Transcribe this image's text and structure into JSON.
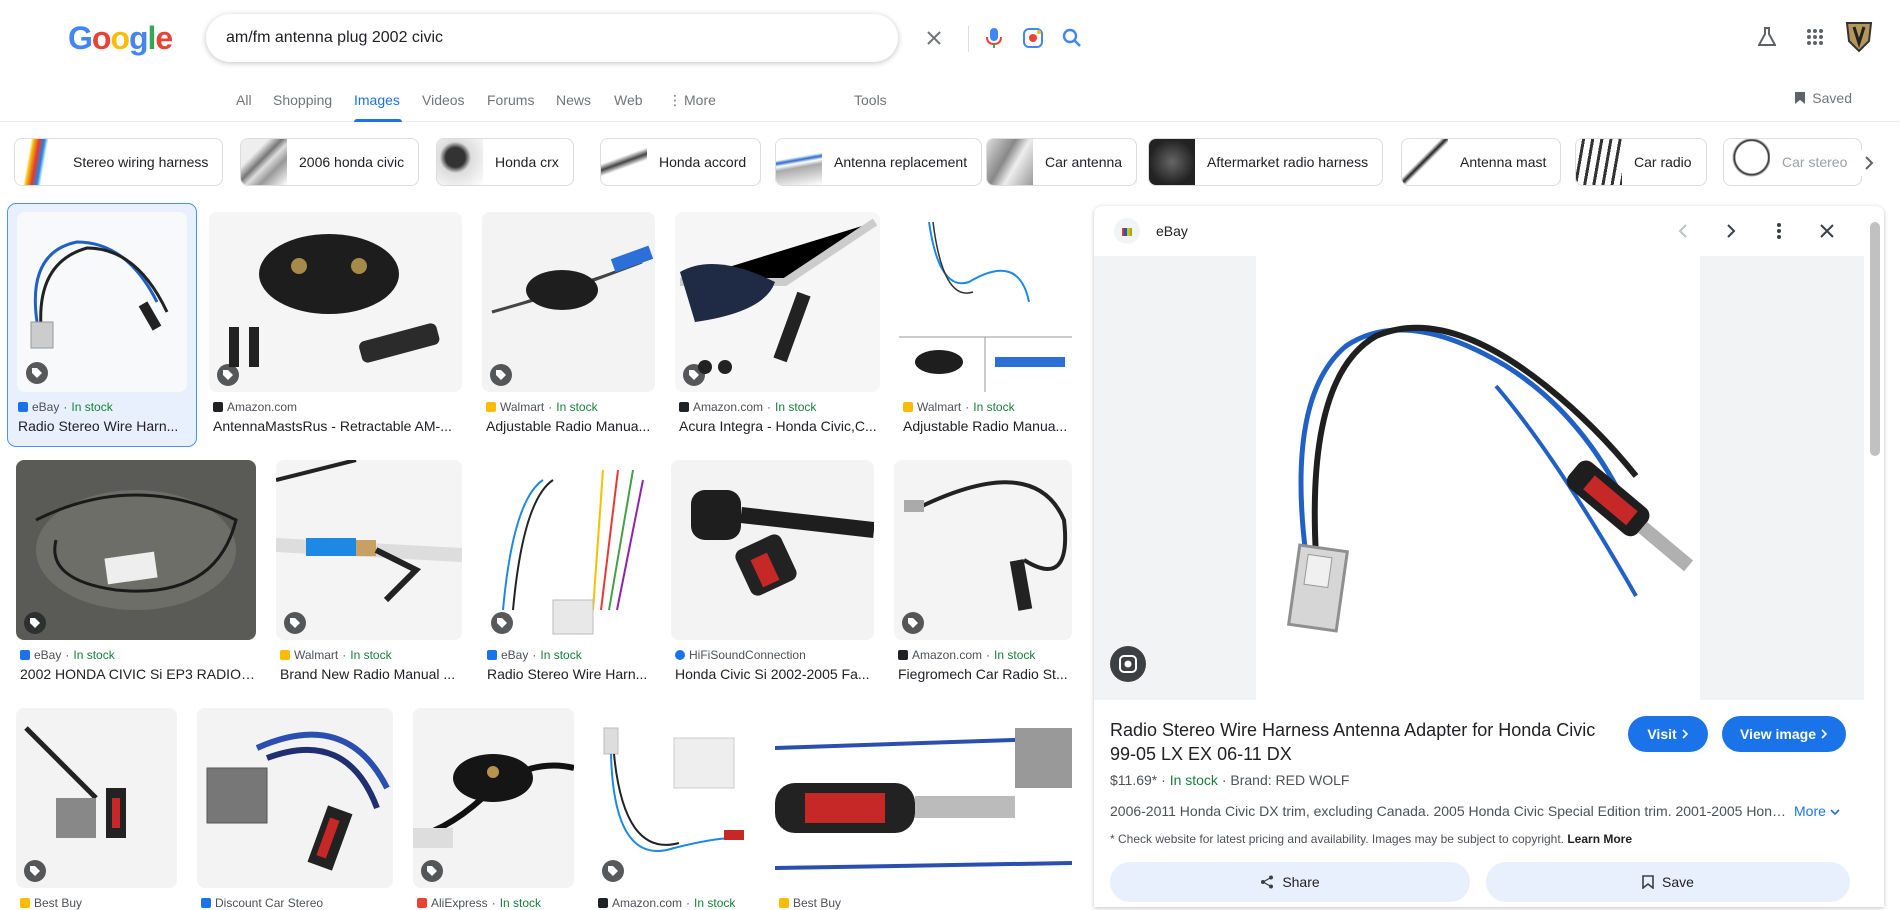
{
  "search": {
    "query": "am/fm antenna plug 2002 civic"
  },
  "logo": {
    "text": "Google"
  },
  "tabs": [
    {
      "label": "All"
    },
    {
      "label": "Shopping"
    },
    {
      "label": "Images"
    },
    {
      "label": "Videos"
    },
    {
      "label": "Forums"
    },
    {
      "label": "News"
    },
    {
      "label": "Web"
    },
    {
      "label": "More"
    },
    {
      "label": "Tools"
    }
  ],
  "saved_label": "Saved",
  "chips": [
    {
      "label": "Stereo wiring harness"
    },
    {
      "label": "2006 honda civic"
    },
    {
      "label": "Honda crx"
    },
    {
      "label": "Honda accord"
    },
    {
      "label": "Antenna replacement"
    },
    {
      "label": "Car antenna"
    },
    {
      "label": "Aftermarket radio harness"
    },
    {
      "label": "Antenna mast"
    },
    {
      "label": "Car radio"
    },
    {
      "label": "Car stereo"
    }
  ],
  "results": [
    {
      "source": "eBay",
      "stock": "In stock",
      "title": "Radio Stereo Wire Harn...",
      "color": "#1a73e8"
    },
    {
      "source": "Amazon.com",
      "stock": "",
      "title": "AntennaMastsRus - Retractable AM-...",
      "color": "#202124"
    },
    {
      "source": "Walmart",
      "stock": "In stock",
      "title": "Adjustable Radio Manua...",
      "color": "#fbbc05"
    },
    {
      "source": "Amazon.com",
      "stock": "In stock",
      "title": "Acura Integra - Honda Civic,C...",
      "color": "#202124"
    },
    {
      "source": "Walmart",
      "stock": "In stock",
      "title": "Adjustable Radio Manua...",
      "color": "#fbbc05"
    },
    {
      "source": "eBay",
      "stock": "In stock",
      "title": "2002 HONDA CIVIC Si EP3 RADIO ...",
      "color": "#1a73e8"
    },
    {
      "source": "Walmart",
      "stock": "In stock",
      "title": "Brand New Radio Manual ...",
      "color": "#fbbc05"
    },
    {
      "source": "eBay",
      "stock": "In stock",
      "title": "Radio Stereo Wire Harn...",
      "color": "#1a73e8"
    },
    {
      "source": "HiFiSoundConnection",
      "stock": "",
      "title": "Honda Civic Si 2002-2005 Fa...",
      "color": "#1a73e8"
    },
    {
      "source": "Amazon.com",
      "stock": "In stock",
      "title": "Fiegromech Car Radio St...",
      "color": "#202124"
    },
    {
      "source": "Best Buy",
      "stock": "",
      "title": "",
      "color": "#fbbc05"
    },
    {
      "source": "Discount Car Stereo",
      "stock": "",
      "title": "",
      "color": "#1a73e8"
    },
    {
      "source": "AliExpress",
      "stock": "In stock",
      "title": "",
      "color": "#ea4335"
    },
    {
      "source": "Amazon.com",
      "stock": "In stock",
      "title": "",
      "color": "#202124"
    },
    {
      "source": "Best Buy",
      "stock": "",
      "title": "",
      "color": "#fbbc05"
    }
  ],
  "panel": {
    "source": "eBay",
    "title": "Radio Stereo Wire Harness Antenna Adapter for Honda Civic 99-05 LX EX 06-11 DX",
    "visit_label": "Visit",
    "view_label": "View image",
    "price": "$11.69*",
    "stock": "In stock",
    "brand": "Brand: RED WOLF",
    "description": "2006-2011 Honda Civic DX trim, excluding Canada. 2005 Honda Civic Special Edition trim. 2001-2005 Honda Civic ...",
    "more_label": "More",
    "note": "* Check website for latest pricing and availability. Images may be subject to copyright.",
    "learn_more": "Learn More",
    "share_label": "Share",
    "save_label": "Save"
  },
  "colors": {
    "accent": "#1a73e8",
    "stock": "#188038"
  }
}
